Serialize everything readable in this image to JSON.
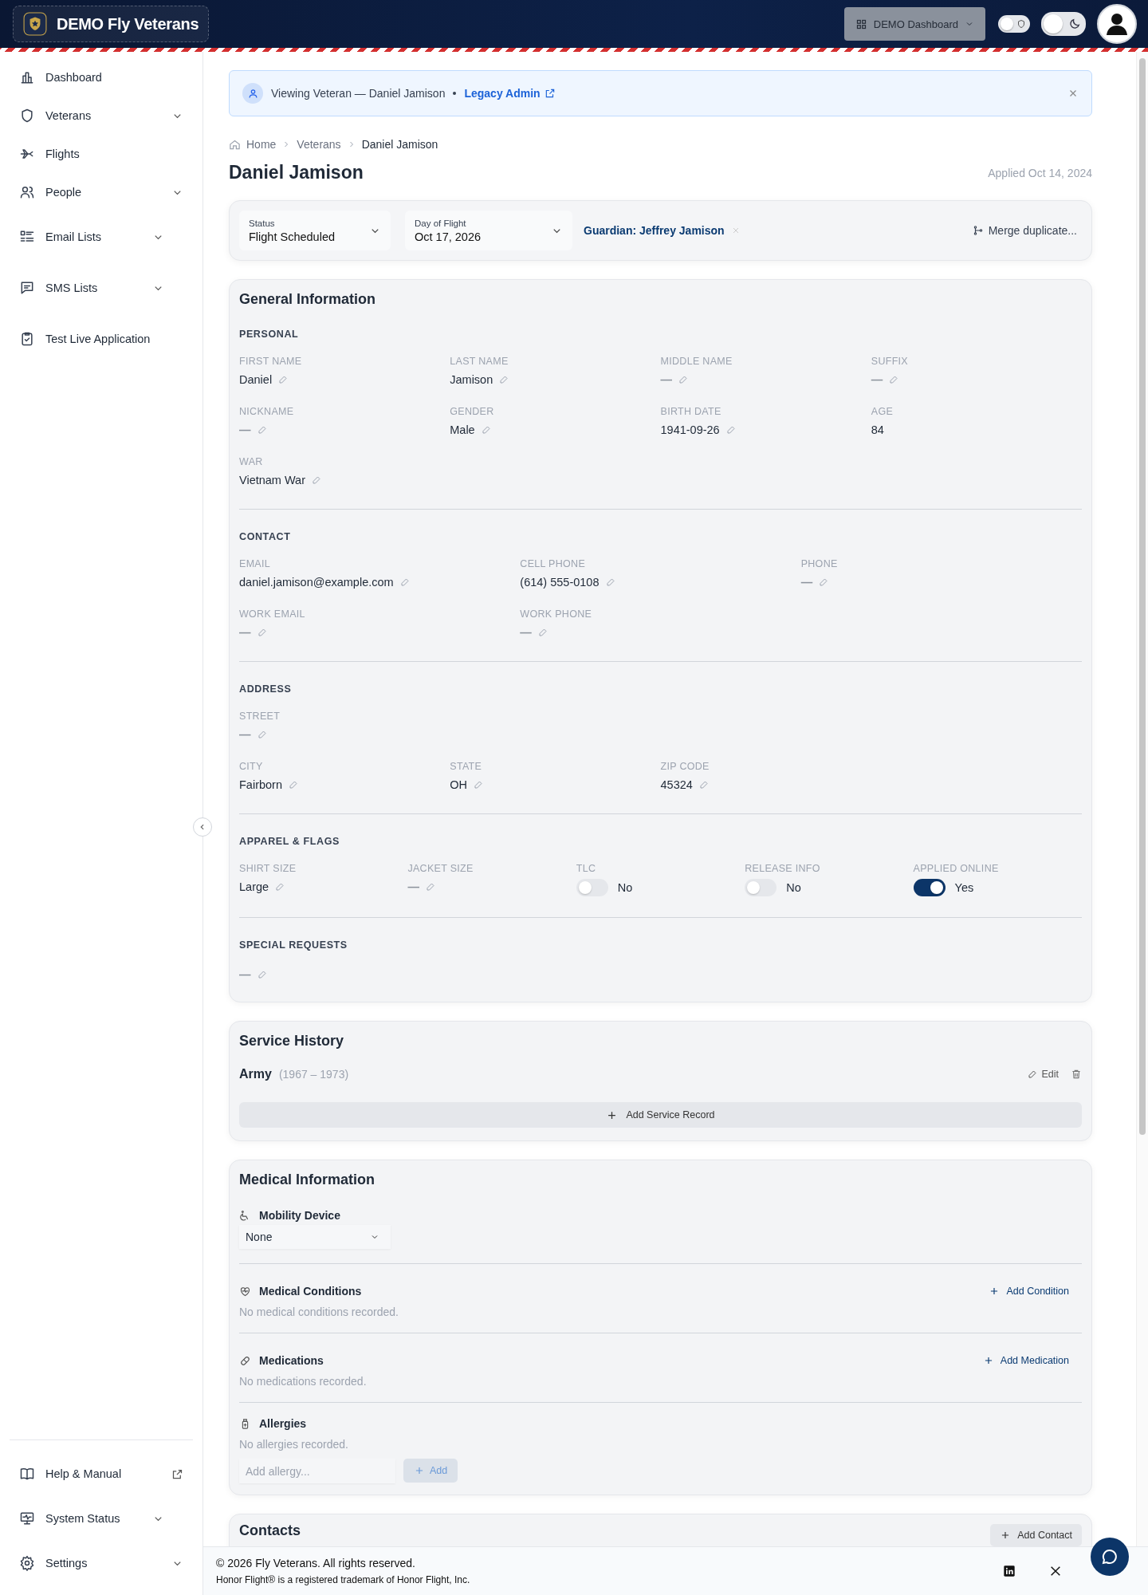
{
  "header": {
    "brand": "DEMO Fly Veterans",
    "dashboard_button": {
      "label": "DEMO Dashboard",
      "disabled": true
    },
    "switches": [
      {
        "kind": "shield",
        "on": false
      },
      {
        "kind": "theme",
        "on": false
      }
    ]
  },
  "sidebar": {
    "items": [
      {
        "label": "Dashboard",
        "kind": "link"
      },
      {
        "label": "Veterans",
        "kind": "group"
      },
      {
        "label": "Flights",
        "kind": "link"
      },
      {
        "label": "People",
        "kind": "group"
      },
      {
        "label": "Email Lists",
        "kind": "group"
      },
      {
        "label": "SMS Lists",
        "kind": "group"
      },
      {
        "label": "Test Live Application",
        "kind": "link"
      }
    ],
    "bottom_items": [
      {
        "label": "Help & Manual",
        "kind": "external"
      },
      {
        "label": "System Status",
        "kind": "group"
      },
      {
        "label": "Settings",
        "kind": "group"
      }
    ]
  },
  "banner": {
    "text": "Viewing Veteran — Daniel Jamison",
    "link": "Legacy Admin"
  },
  "breadcrumb": [
    "Home",
    "Veterans",
    "Daniel Jamison"
  ],
  "title": "Daniel Jamison",
  "applied": "Applied Oct 14, 2024",
  "status_bar": {
    "status": {
      "label": "Status",
      "value": "Flight Scheduled"
    },
    "flight_day": {
      "label": "Day of Flight",
      "value": "Oct 17, 2026"
    },
    "guardian": "Guardian: Jeffrey Jamison",
    "merge": "Merge duplicate..."
  },
  "general": {
    "title": "General Information",
    "sections": [
      {
        "title": "PERSONAL",
        "rows": [
          [
            {
              "label": "FIRST NAME",
              "kind": "text",
              "value": "Daniel",
              "editable": true
            },
            {
              "label": "LAST NAME",
              "kind": "text",
              "value": "Jamison",
              "editable": true
            },
            {
              "label": "MIDDLE NAME",
              "kind": "text",
              "value": "—",
              "editable": true
            },
            {
              "label": "SUFFIX",
              "kind": "text",
              "value": "—",
              "editable": true
            }
          ],
          [
            {
              "label": "NICKNAME",
              "kind": "text",
              "value": "—",
              "editable": true
            },
            {
              "label": "GENDER",
              "kind": "text",
              "value": "Male",
              "editable": true
            },
            {
              "label": "BIRTH DATE",
              "kind": "text",
              "value": "1941-09-26",
              "editable": true
            },
            {
              "label": "AGE",
              "kind": "text",
              "value": "84",
              "editable": false
            }
          ],
          [
            {
              "label": "WAR",
              "kind": "text",
              "value": "Vietnam War",
              "editable": true
            }
          ]
        ]
      },
      {
        "title": "CONTACT",
        "rows": [
          [
            {
              "label": "EMAIL",
              "kind": "text",
              "value": "daniel.jamison@example.com",
              "editable": true
            },
            {
              "label": "CELL PHONE",
              "kind": "text",
              "value": "(614) 555-0108",
              "editable": true
            },
            {
              "label": "PHONE",
              "kind": "text",
              "value": "—",
              "editable": true
            }
          ],
          [
            {
              "label": "WORK EMAIL",
              "kind": "text",
              "value": "—",
              "editable": true
            },
            {
              "label": "WORK PHONE",
              "kind": "text",
              "value": "—",
              "editable": true
            }
          ]
        ]
      },
      {
        "title": "ADDRESS",
        "rows": [
          [
            {
              "label": "STREET",
              "kind": "text",
              "value": "—",
              "editable": true
            }
          ],
          [
            {
              "label": "CITY",
              "kind": "text",
              "value": "Fairborn",
              "editable": true
            },
            {
              "label": "STATE",
              "kind": "text",
              "value": "OH",
              "editable": true
            },
            {
              "label": "ZIP CODE",
              "kind": "text",
              "value": "45324",
              "editable": true
            }
          ]
        ]
      },
      {
        "title": "APPAREL & FLAGS",
        "rows": [
          [
            {
              "label": "SHIRT SIZE",
              "kind": "text",
              "value": "Large",
              "editable": true
            },
            {
              "label": "JACKET SIZE",
              "kind": "text",
              "value": "—",
              "editable": true
            },
            {
              "label": "TLC",
              "kind": "toggle",
              "on": false,
              "value": "No"
            },
            {
              "label": "RELEASE INFO",
              "kind": "toggle",
              "on": false,
              "value": "No"
            },
            {
              "label": "APPLIED ONLINE",
              "kind": "toggle",
              "on": true,
              "value": "Yes"
            }
          ]
        ]
      },
      {
        "title": "SPECIAL REQUESTS",
        "rows": [
          [
            {
              "kind": "text",
              "value": "—",
              "editable": true
            }
          ]
        ]
      }
    ]
  },
  "service": {
    "title": "Service History",
    "records": [
      {
        "branch": "Army",
        "years": "(1967 – 1973)",
        "edit": "Edit"
      }
    ],
    "add": "Add Service Record"
  },
  "medical": {
    "title": "Medical Information",
    "mobility": {
      "label": "Mobility Device",
      "value": "None"
    },
    "conditions": {
      "title": "Medical Conditions",
      "add": "Add Condition",
      "empty": "No medical conditions recorded."
    },
    "medications": {
      "title": "Medications",
      "add": "Add Medication",
      "empty": "No medications recorded."
    },
    "allergies": {
      "title": "Allergies",
      "empty": "No allergies recorded.",
      "placeholder": "Add allergy...",
      "add": "Add",
      "add_disabled": true
    }
  },
  "contacts": {
    "title": "Contacts",
    "add": "Add Contact"
  },
  "footer": {
    "copyright": "© 2026 Fly Veterans. All rights reserved.",
    "trademark": "Honor Flight® is a registered trademark of Honor Flight, Inc."
  }
}
